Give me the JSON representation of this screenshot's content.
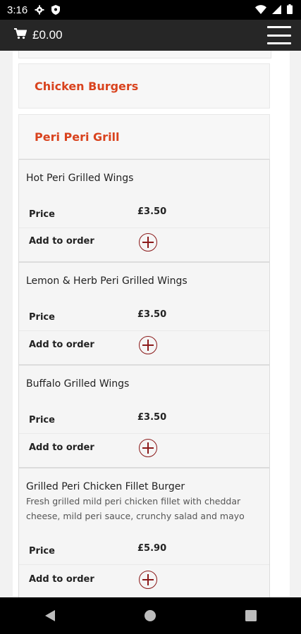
{
  "status_bar": {
    "time": "3:16",
    "icons": [
      "gear-icon",
      "shield-icon",
      "wifi-icon",
      "signal-icon",
      "battery-icon"
    ]
  },
  "app_bar": {
    "cart_amount": "£0.00",
    "cart_icon": "cart-icon",
    "menu_icon": "hamburger-menu-icon"
  },
  "categories": [
    {
      "title": "Chicken Burgers"
    },
    {
      "title": "Peri Peri Grill"
    }
  ],
  "items": [
    {
      "name": "Hot Peri Grilled Wings",
      "description": "",
      "price_label": "Price",
      "price": "£3.50",
      "add_label": "Add to order"
    },
    {
      "name": "Lemon & Herb Peri Grilled Wings",
      "description": "",
      "price_label": "Price",
      "price": "£3.50",
      "add_label": "Add to order"
    },
    {
      "name": "Buffalo Grilled Wings",
      "description": "",
      "price_label": "Price",
      "price": "£3.50",
      "add_label": "Add to order"
    },
    {
      "name": "Grilled Peri Chicken Fillet Burger",
      "description": "Fresh grilled mild peri chicken fillet with cheddar cheese, mild peri sauce, crunchy salad and mayo",
      "price_label": "Price",
      "price": "£5.90",
      "add_label": "Add to order"
    }
  ],
  "colors": {
    "category_title": "#d9431e",
    "add_button": "#8b1a1a",
    "app_bar": "#262626"
  },
  "nav_bar": {
    "icons": [
      "back-icon",
      "home-icon",
      "recents-icon"
    ]
  }
}
